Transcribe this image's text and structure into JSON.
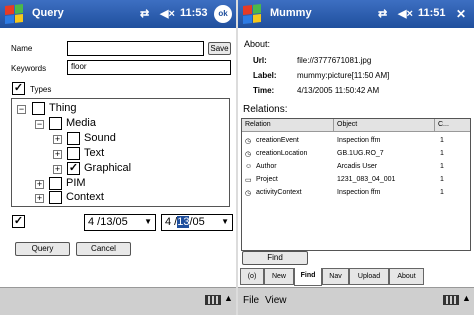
{
  "left": {
    "title": "Query",
    "status_icons": [
      "connectivity-icon",
      "speaker-mute-icon"
    ],
    "time": "11:53",
    "ok": "ok",
    "name_label": "Name",
    "name_value": "",
    "save_label": "Save",
    "keywords_label": "Keywords",
    "keywords_value": "floor",
    "types_label": "Types",
    "types_checked": true,
    "tree": [
      {
        "label": "Thing",
        "checked": false
      },
      {
        "label": "Media",
        "checked": false
      },
      {
        "label": "Sound",
        "checked": false
      },
      {
        "label": "Text",
        "checked": false
      },
      {
        "label": "Graphical",
        "checked": true
      },
      {
        "label": "PIM",
        "checked": false
      },
      {
        "label": "Context",
        "checked": false
      }
    ],
    "date_checked": true,
    "date_from": "4 /13/05",
    "date_to_pre": "4 /",
    "date_to_sel": "13",
    "date_to_post": "/05",
    "query_label": "Query",
    "cancel_label": "Cancel"
  },
  "right": {
    "title": "Mummy",
    "time": "11:51",
    "about_label": "About:",
    "url_label": "Url:",
    "url_value": "file://3777671081.jpg",
    "label_label": "Label:",
    "label_value": "mummy:picture[11:50 AM]",
    "time_label": "Time:",
    "time_value": "4/13/2005 11:50:42 AM",
    "relations_label": "Relations:",
    "columns": [
      "Relation",
      "Object",
      "C..."
    ],
    "rows": [
      {
        "relation": "creationEvent",
        "object": "Inspection ffm",
        "count": "1"
      },
      {
        "relation": "creationLocation",
        "object": "GB.1UG.RO_7",
        "count": "1"
      },
      {
        "relation": "Author",
        "object": "Arcadis User",
        "count": "1"
      },
      {
        "relation": "Project",
        "object": "1231_083_04_001",
        "count": "1"
      },
      {
        "relation": "activityContext",
        "object": "Inspection ffm",
        "count": "1"
      }
    ],
    "find_label": "Find",
    "tabs": [
      "(o)",
      "New",
      "Find",
      "Nav",
      "Upload",
      "About"
    ],
    "active_tab": "Find",
    "menu": [
      "File",
      "View"
    ]
  }
}
